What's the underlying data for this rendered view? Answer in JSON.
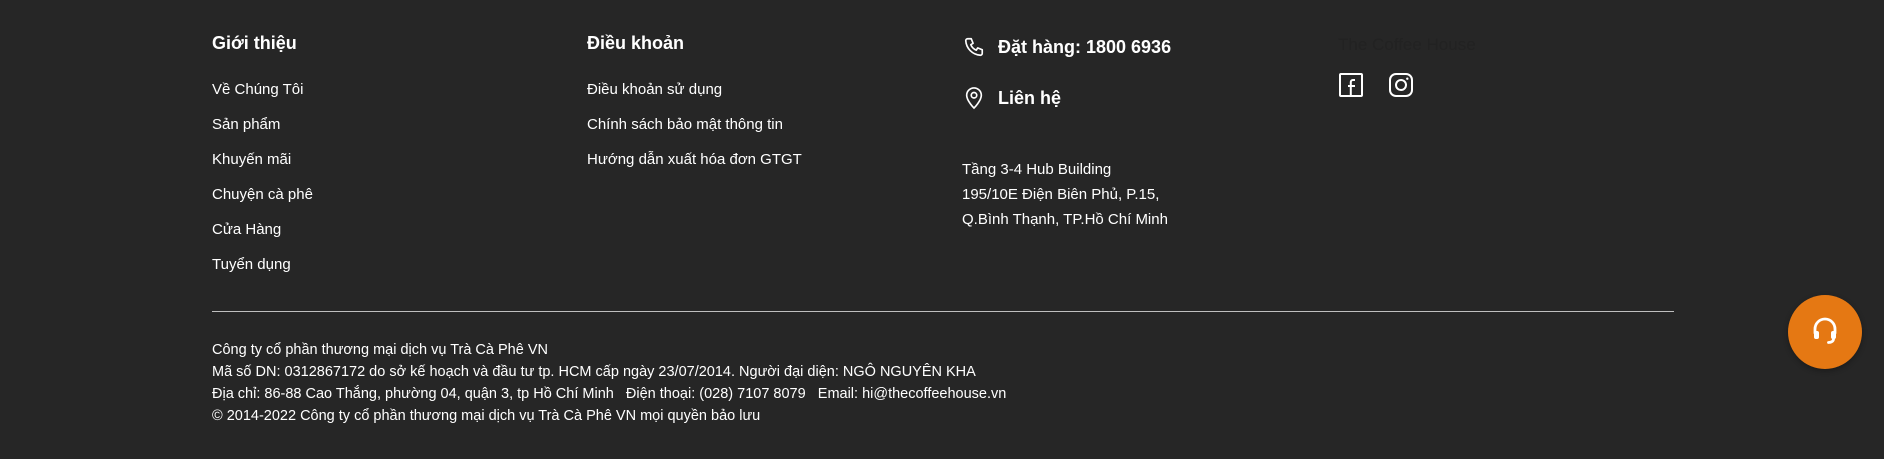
{
  "about": {
    "title": "Giới thiệu",
    "links": [
      "Về Chúng Tôi",
      "Sản phẩm",
      "Khuyến mãi",
      "Chuyện cà phê",
      "Cửa Hàng",
      "Tuyển dụng"
    ]
  },
  "terms": {
    "title": "Điều khoản",
    "links": [
      "Điều khoản sử dụng",
      "Chính sách bảo mật thông tin",
      "Hướng dẫn xuất hóa đơn GTGT"
    ]
  },
  "contact": {
    "order": "Đặt hàng: 1800 6936",
    "contact_label": "Liên hệ",
    "address": [
      "Tầng 3-4 Hub Building",
      "195/10E Điện Biên Phủ, P.15,",
      "Q.Bình Thạnh, TP.Hồ Chí Minh"
    ],
    "phone_icon": "phone-icon",
    "location_icon": "location-pin-icon"
  },
  "brand": {
    "name": "The Coffee House",
    "socials": [
      "facebook-icon",
      "instagram-icon"
    ]
  },
  "legal": [
    "Công ty cổ phần thương mại dịch vụ Trà Cà Phê VN",
    "Mã số DN: 0312867172 do sở kế hoạch và đầu tư tp. HCM cấp ngày 23/07/2014. Người đại diện: NGÔ NGUYÊN KHA",
    "Địa chỉ: 86-88 Cao Thắng, phường 04, quận 3, tp Hồ Chí Minh   Điện thoại: (028) 7107 8079   Email: hi@thecoffeehouse.vn",
    "© 2014-2022 Công ty cổ phần thương mại dịch vụ Trà Cà Phê VN mọi quyền bảo lưu"
  ],
  "support_button": {
    "icon": "headset-icon"
  },
  "colors": {
    "background": "#262626",
    "accent": "#e57813",
    "text": "#ffffff"
  }
}
